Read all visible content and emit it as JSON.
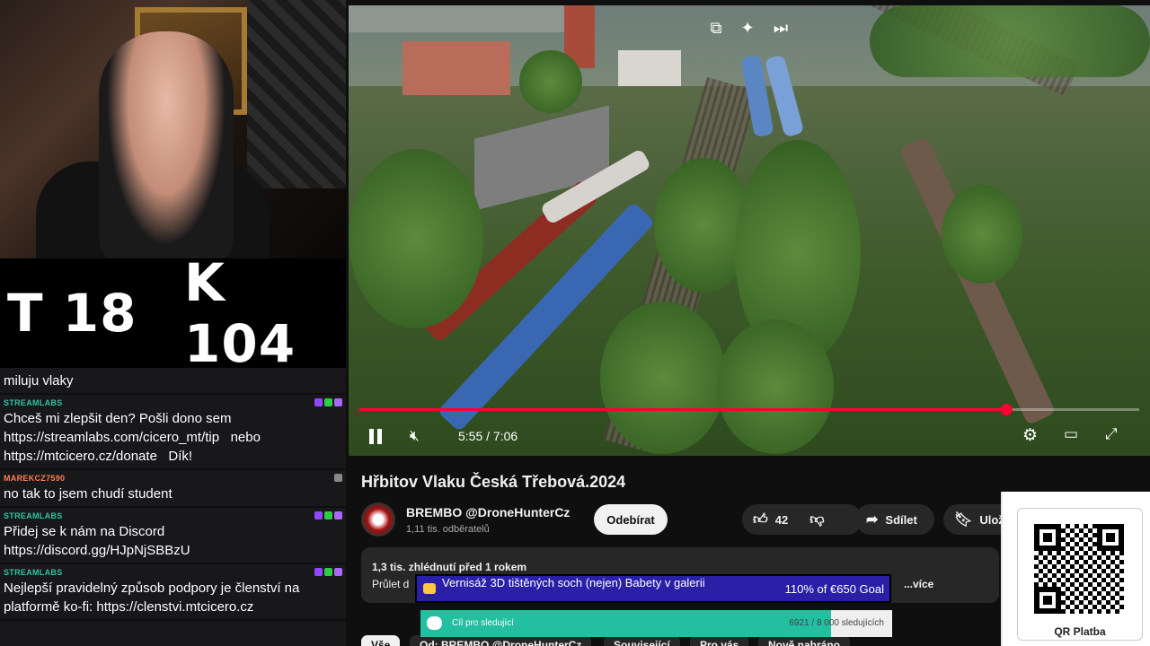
{
  "stream": {
    "score_t": "T 18",
    "score_k": "K 104"
  },
  "chat": {
    "messages": [
      {
        "user": "",
        "user_color": "#ffffff",
        "text": "miluju vlaky"
      },
      {
        "user": "STREAMLABS",
        "user_color": "#31c3a2",
        "text": "Chceš mi zlepšit den? Pošli dono sem   https://streamlabs.com/cicero_mt/tip   nebo https://mtcicero.cz/donate   Dík!"
      },
      {
        "user": "MAREKCZ7590",
        "user_color": "#ff7f50",
        "text": "no tak to jsem chudí student"
      },
      {
        "user": "STREAMLABS",
        "user_color": "#31c3a2",
        "text": "Přidej se k nám na Discord   https://discord.gg/HJpNjSBBzU"
      },
      {
        "user": "STREAMLABS",
        "user_color": "#31c3a2",
        "text": "Nejlepší pravidelný způsob podpory je členství na platformě ko-fi: https://clenstvi.mtcicero.cz"
      }
    ]
  },
  "player": {
    "time": "5:55 / 7:06",
    "progress": 0.83,
    "icons": [
      "pause-icon",
      "mute-icon",
      "settings-icon",
      "theater-icon",
      "fullscreen-icon",
      "miniplayer-icon",
      "autoplay-icon",
      "skip-icon"
    ],
    "accent": "#ff0033"
  },
  "video": {
    "title": "Hřbitov Vlaku Česká Třebová.2024",
    "channel": "BREMBO @DroneHunterCz",
    "subscribers": "1,11 tis. odběratelů",
    "subscribe_label": "Odebírat",
    "likes": "42",
    "share_label": "Sdílet",
    "save_label": "Ulož",
    "views_line": "1,3 tis. zhlédnutí  před 1 rokem",
    "desc_start": "Průlet d",
    "more_label": "...více"
  },
  "chips": [
    "Vše",
    "Od: BREMBO @DroneHunterCz",
    "Související",
    "Pro vás",
    "Nově nahráno"
  ],
  "goal1": {
    "title": "Vernisáž 3D tištěných soch (nejen) Babety v galerii",
    "amount": "110% of €650 Goal",
    "progress": 1.0
  },
  "goal2": {
    "title": "Cíl pro sledující",
    "amount": "6921 / 8 000 sledujících",
    "progress": 0.87
  },
  "qr": {
    "label": "QR Platba"
  }
}
